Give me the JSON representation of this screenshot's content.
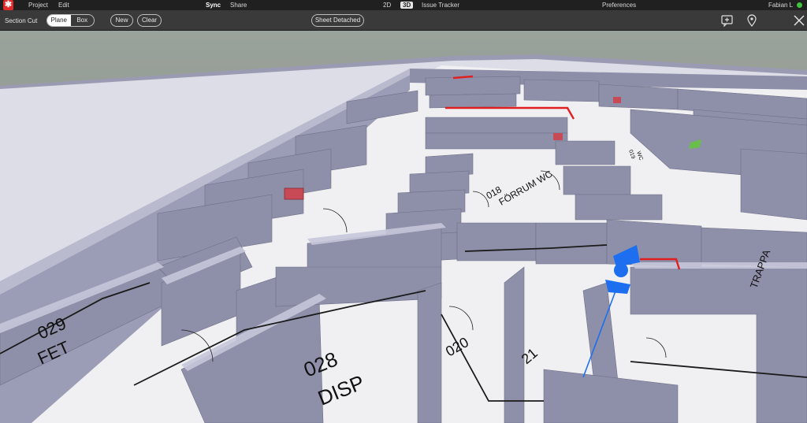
{
  "app": {
    "logo": "✱",
    "menu": {
      "project": "Project",
      "edit": "Edit",
      "sync": "Sync",
      "share": "Share",
      "view_2d": "2D",
      "view_3d": "3D",
      "issue_tracker": "Issue Tracker",
      "preferences": "Preferences",
      "user": "Fabian L"
    }
  },
  "toolbar": {
    "section_cut_label": "Section Cut",
    "mode_plane": "Plane",
    "mode_box": "Box",
    "selected_mode": "Plane",
    "new_label": "New",
    "clear_label": "Clear",
    "sheet_status": "Sheet Detached",
    "icons": [
      "add-comment-icon",
      "location-pin-icon",
      "close-icon"
    ]
  },
  "model": {
    "room_labels": {
      "r029_num": "029",
      "r029_name": "FET",
      "r028_num": "028",
      "r028_name": "DISP",
      "r018_num": "018",
      "r018_name": "FÖRRUM WC",
      "r020_num": "020",
      "r021_num": "21",
      "trappa": "TRAPPA",
      "r019_num": "019",
      "r019_name": "WC"
    },
    "colors": {
      "accent_red": "#e02020",
      "pin_red": "#c84a56",
      "pin_green": "#6abf4a",
      "marker_blue": "#1e6ff0",
      "wall": "#8e8fa8",
      "wall_top": "#c8c9dc",
      "floor": "#f2f2f4",
      "ground": "#8d9288"
    }
  }
}
